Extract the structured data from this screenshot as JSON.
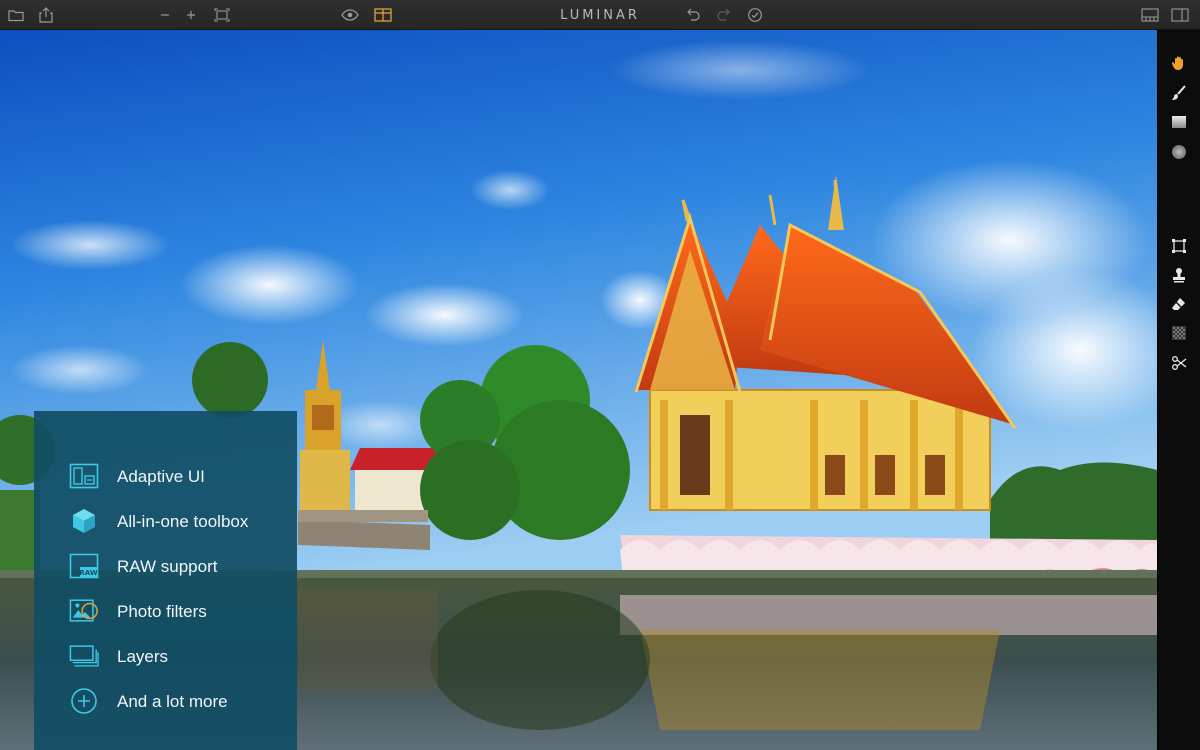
{
  "app": {
    "title": "LUMINAR"
  },
  "toolbar": {
    "left_icons": [
      "folder-icon",
      "share-icon",
      "zoom-out-icon",
      "zoom-in-icon",
      "fit-screen-icon"
    ],
    "center_icons": [
      "preview-eye-icon",
      "compare-split-icon"
    ],
    "history_icons": [
      "undo-icon",
      "redo-icon",
      "history-check-icon"
    ],
    "right_icons": [
      "layout-filmstrip-icon",
      "layout-panels-icon"
    ]
  },
  "tools": {
    "items": [
      "hand-icon",
      "brush-icon",
      "gradient-mask-icon",
      "radial-mask-icon",
      "crop-icon",
      "clone-stamp-icon",
      "eraser-icon",
      "noise-icon",
      "transform-scissors-icon"
    ],
    "active": "hand-icon",
    "active_color": "#f0a030"
  },
  "features": {
    "items": [
      {
        "label": "Adaptive UI",
        "icon": "adaptive-ui-icon"
      },
      {
        "label": "All-in-one toolbox",
        "icon": "toolbox-cube-icon"
      },
      {
        "label": "RAW support",
        "icon": "raw-file-icon"
      },
      {
        "label": "Photo filters",
        "icon": "photo-filter-icon"
      },
      {
        "label": "Layers",
        "icon": "layers-icon"
      },
      {
        "label": "And a lot more",
        "icon": "plus-circle-icon"
      }
    ],
    "icon_color": "#3fc8e4",
    "panel_color": "#114e64"
  },
  "photo": {
    "subject": "temple-by-water-photo"
  }
}
